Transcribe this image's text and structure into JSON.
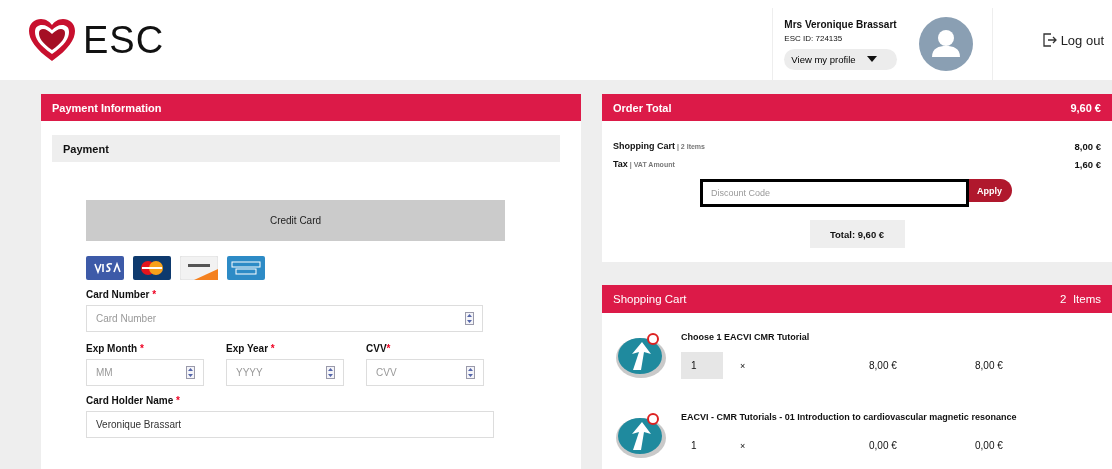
{
  "header": {
    "logo_text": "ESC",
    "user_name": "Mrs Veronique Brassart",
    "esc_id": "ESC ID: 724135",
    "profile_button": "View my profile",
    "logout": "Log out"
  },
  "payment": {
    "title": "Payment Information",
    "section": "Payment",
    "method": "Credit Card",
    "card_brands": [
      {
        "kind": "visa"
      },
      {
        "kind": "mastercard"
      },
      {
        "kind": "discover"
      },
      {
        "kind": "amex"
      }
    ],
    "rows": [
      {
        "fields": [
          {
            "label": "Card Number",
            "mark": " *",
            "placeholder": "Card Number",
            "spinner": true
          }
        ]
      },
      {
        "fields": [
          {
            "label": "Exp Month",
            "mark": " *",
            "placeholder": "MM",
            "spinner": true
          },
          {
            "label": "Exp Year",
            "mark": " *",
            "placeholder": "YYYY",
            "spinner": true
          },
          {
            "label": "CVV",
            "mark": "*",
            "placeholder": "CVV",
            "spinner": true
          }
        ]
      },
      {
        "fields": [
          {
            "label": "Card Holder Name",
            "mark": " *",
            "value": "Veronique Brassart",
            "spinner": false
          }
        ]
      }
    ]
  },
  "order_total": {
    "title": "Order Total",
    "amount": "9,60 €",
    "lines": [
      {
        "label": "Shopping Cart",
        "note": "| 2 Items",
        "amount": "8,00 €"
      },
      {
        "label": "Tax",
        "note": "| VAT Amount",
        "amount": "1,60 €"
      }
    ],
    "discount": {
      "placeholder": "Discount Code",
      "button": "Apply"
    },
    "total": "Total: 9,60 €"
  },
  "cart": {
    "title": "Shopping Cart",
    "count": "2  Items",
    "items": [
      {
        "name": "Choose 1 EACVI CMR Tutorial",
        "quantity": "1",
        "quantity_editable": true,
        "times": "×",
        "price": "8,00 €",
        "total": "8,00 €"
      },
      {
        "name": "EACVI - CMR Tutorials - 01 Introduction to cardiovascular magnetic resonance",
        "quantity": "1",
        "quantity_editable": false,
        "times": "×",
        "price": "0,00 €",
        "total": "0,00 €"
      }
    ]
  }
}
